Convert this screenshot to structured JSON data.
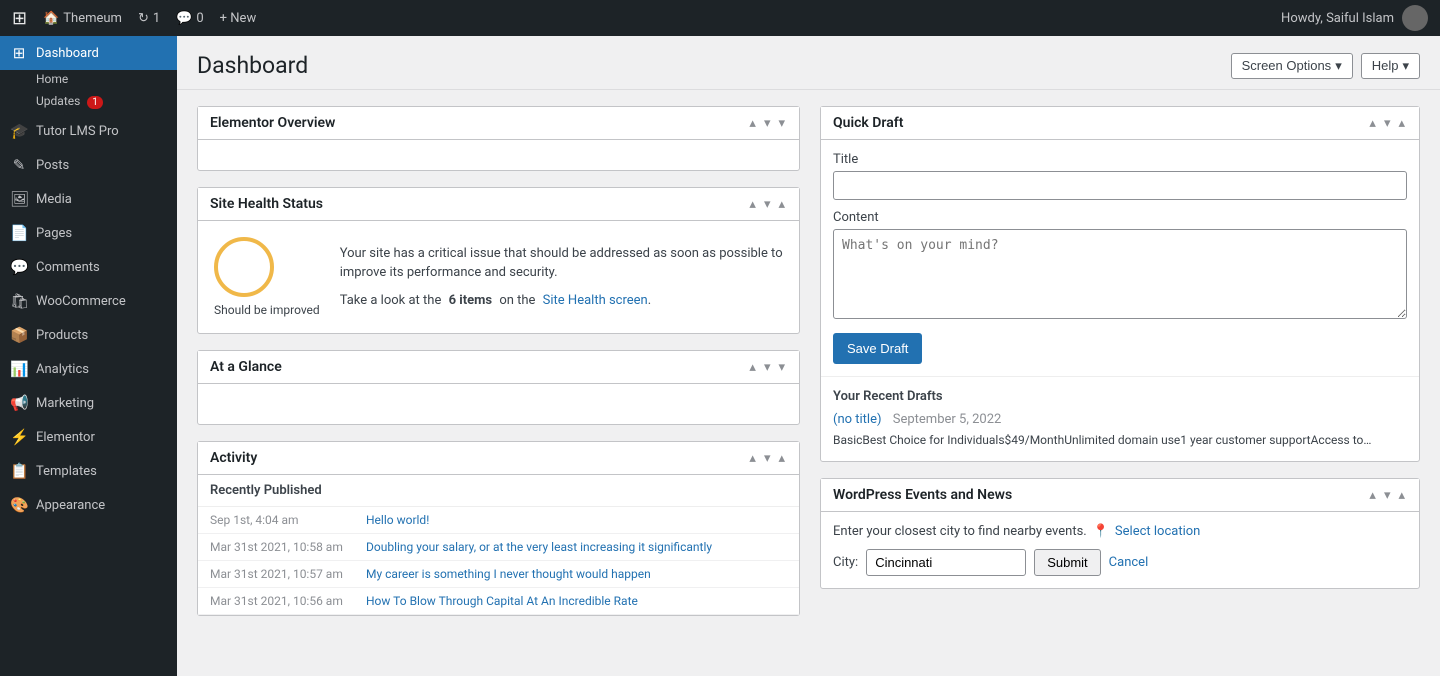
{
  "adminbar": {
    "logo": "W",
    "site_name": "Themeum",
    "updates_label": "1",
    "comments_label": "0",
    "new_label": "+ New",
    "user_greeting": "Howdy, Saiful Islam"
  },
  "header": {
    "title": "Dashboard",
    "screen_options": "Screen Options",
    "help": "Help"
  },
  "sidebar": {
    "home_label": "Home",
    "updates_label": "Updates",
    "updates_badge": "1",
    "tutor_lms": "Tutor LMS Pro",
    "posts": "Posts",
    "media": "Media",
    "pages": "Pages",
    "comments": "Comments",
    "woocommerce": "WooCommerce",
    "products": "Products",
    "analytics": "Analytics",
    "marketing": "Marketing",
    "elementor": "Elementor",
    "templates": "Templates",
    "appearance": "Appearance"
  },
  "widgets": {
    "elementor_overview": {
      "title": "Elementor Overview"
    },
    "site_health": {
      "title": "Site Health Status",
      "status_label": "Should be improved",
      "message": "Your site has a critical issue that should be addressed as soon as possible to improve its performance and security.",
      "items_count": "6 items",
      "cta_prefix": "Take a look at the",
      "cta_link_text": "Site Health screen",
      "cta_suffix": "."
    },
    "at_a_glance": {
      "title": "At a Glance"
    },
    "activity": {
      "title": "Activity",
      "recently_published": "Recently Published",
      "rows": [
        {
          "date": "Sep 1st, 4:04 am",
          "link": "Hello world!"
        },
        {
          "date": "Mar 31st 2021, 10:58 am",
          "link": "Doubling your salary, or at the very least increasing it significantly"
        },
        {
          "date": "Mar 31st 2021, 10:57 am",
          "link": "My career is something I never thought would happen"
        },
        {
          "date": "Mar 31st 2021, 10:56 am",
          "link": "How To Blow Through Capital At An Incredible Rate"
        }
      ]
    }
  },
  "quick_draft": {
    "title": "Quick Draft",
    "title_label": "Title",
    "content_label": "Content",
    "content_placeholder": "What's on your mind?",
    "save_button": "Save Draft",
    "recent_drafts_title": "Your Recent Drafts",
    "draft_link": "(no title)",
    "draft_date": "September 5, 2022",
    "draft_preview": "BasicBest Choice for Individuals$49/MonthUnlimited domain use1 year customer supportAccess to…"
  },
  "events": {
    "title": "WordPress Events and News",
    "location_prompt": "Enter your closest city to find nearby events.",
    "select_location_text": "Select location",
    "city_label": "City:",
    "city_value": "Cincinnati",
    "submit_label": "Submit",
    "cancel_label": "Cancel"
  }
}
